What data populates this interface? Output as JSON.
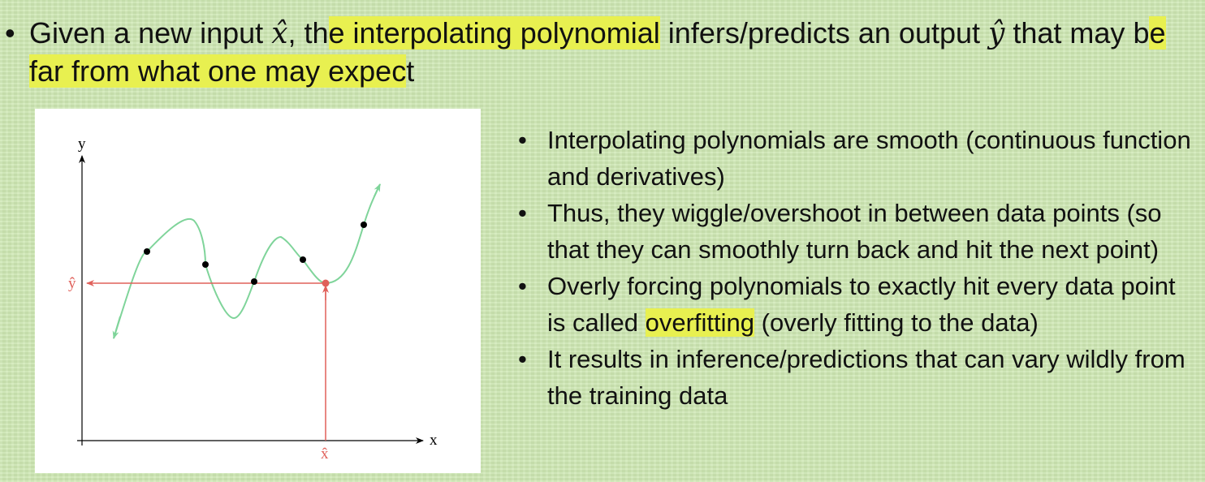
{
  "main_bullet": {
    "p1": "Given a new input ",
    "x_hat": "x̂",
    "p2": ", th",
    "hl1": "e interpolating polynomial",
    "p3": " infers/predicts an output ",
    "y_hat": "ŷ",
    "p4": " that may b",
    "hl2": "e far from what one may expec",
    "p5": "t"
  },
  "figure": {
    "y_axis_label": "y",
    "x_axis_label": "x",
    "y_hat_label": "ŷ",
    "x_hat_label": "x̂",
    "curve_color": "#7fd49a",
    "guide_color": "#e0605a",
    "point_color": "#000000"
  },
  "side_bullets": [
    {
      "text": "Interpolating polynomials are smooth (continuous function and derivatives)"
    },
    {
      "text": "Thus, they wiggle/overshoot in between data points (so that they can smoothly turn back and hit the next point)"
    },
    {
      "before": "Overly forcing polynomials to exactly hit every data point is called ",
      "hl": "overfitting",
      "after": " (overly fitting to the data)"
    },
    {
      "text": "It results in inference/predictions that can vary wildly from the training data"
    }
  ],
  "colors": {
    "highlight": "#e8f050",
    "background": "#cfe8b4"
  }
}
